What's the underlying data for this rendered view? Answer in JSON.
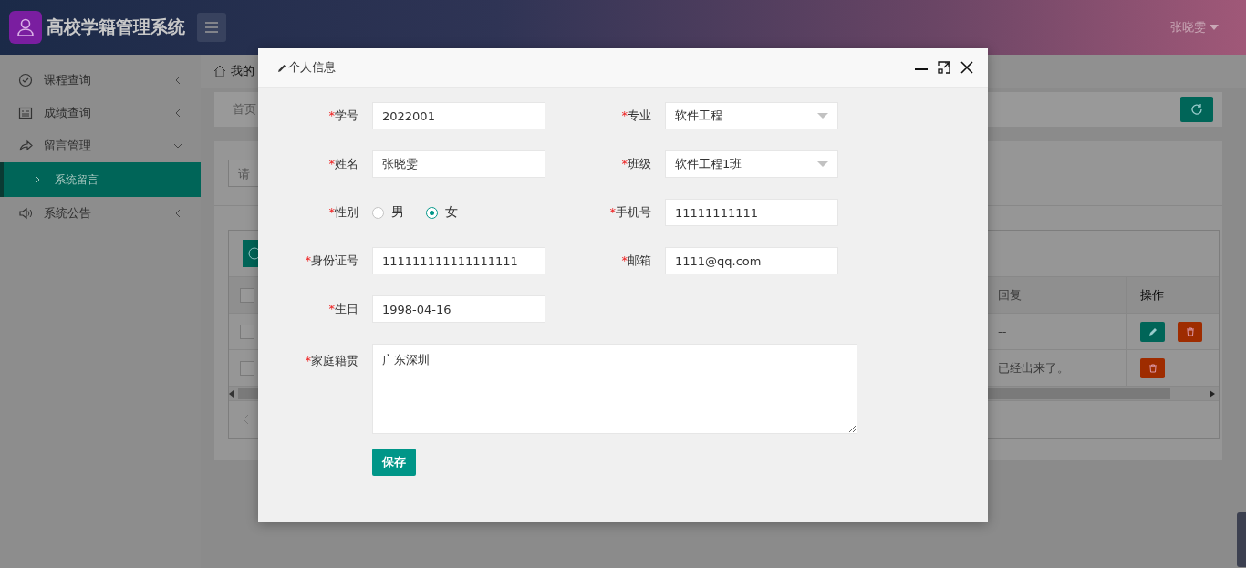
{
  "header": {
    "title": "高校学籍管理系统",
    "user": "张晓雯"
  },
  "sidebar": {
    "items": [
      {
        "label": "课程查询",
        "expanded": false,
        "selected": false
      },
      {
        "label": "成绩查询",
        "expanded": false,
        "selected": false
      },
      {
        "label": "留言管理",
        "expanded": true,
        "selected": false,
        "children": [
          {
            "label": "系统留言",
            "selected": true
          }
        ]
      },
      {
        "label": "系统公告",
        "expanded": false,
        "selected": false
      }
    ]
  },
  "breadcrumb": "我的",
  "tabs": [
    {
      "label": "首页"
    }
  ],
  "search": {
    "placeholder": "请"
  },
  "table": {
    "select_all_checked": false,
    "columns": [
      "回复",
      "操作"
    ],
    "rows": [
      {
        "checked": false,
        "reply": "--",
        "actions": [
          {
            "kind": "edit"
          },
          {
            "kind": "delete"
          }
        ]
      },
      {
        "checked": false,
        "reply": "已经出来了。",
        "actions": [
          {
            "kind": "delete"
          }
        ]
      }
    ]
  },
  "dialog": {
    "title": "个人信息",
    "fields": [
      {
        "kind": "text",
        "required_mark": "*",
        "label": "学号",
        "value": "2022001"
      },
      {
        "kind": "select",
        "required_mark": "*",
        "label": "专业",
        "value": "软件工程"
      },
      {
        "kind": "text",
        "required_mark": "*",
        "label": "姓名",
        "value": "张晓雯"
      },
      {
        "kind": "select",
        "required_mark": "*",
        "label": "班级",
        "value": "软件工程1班"
      },
      {
        "kind": "radio",
        "required_mark": "*",
        "label": "性别",
        "options": [
          {
            "label": "男",
            "selected": false
          },
          {
            "label": "女",
            "selected": true
          }
        ]
      },
      {
        "kind": "text",
        "required_mark": "*",
        "label": "手机号",
        "value": "11111111111"
      },
      {
        "kind": "text",
        "required_mark": "*",
        "label": "身份证号",
        "value": "111111111111111111"
      },
      {
        "kind": "text",
        "required_mark": "*",
        "label": "邮箱",
        "value": "1111@qq.com"
      },
      {
        "kind": "text",
        "required_mark": "*",
        "label": "生日",
        "value": "1998-04-16"
      },
      {
        "kind": "textarea",
        "required_mark": "*",
        "label": "家庭籍贯",
        "value": "广东深圳"
      }
    ],
    "save": "保存"
  }
}
